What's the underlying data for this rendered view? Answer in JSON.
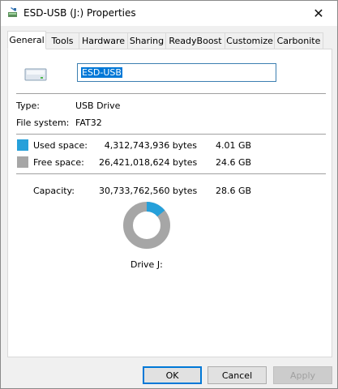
{
  "window": {
    "title": "ESD-USB (J:) Properties",
    "close_glyph": "✕"
  },
  "tabs": [
    {
      "label": "General",
      "active": true
    },
    {
      "label": "Tools",
      "active": false
    },
    {
      "label": "Hardware",
      "active": false
    },
    {
      "label": "Sharing",
      "active": false
    },
    {
      "label": "ReadyBoost",
      "active": false
    },
    {
      "label": "Customize",
      "active": false
    },
    {
      "label": "Carbonite",
      "active": false
    }
  ],
  "general": {
    "drive_icon": "usb-drive-icon",
    "name_value": "ESD-USB",
    "type_label": "Type:",
    "type_value": "USB Drive",
    "fs_label": "File system:",
    "fs_value": "FAT32",
    "used": {
      "label": "Used space:",
      "bytes": "4,312,743,936 bytes",
      "size": "4.01 GB",
      "color": "#26a0da",
      "fraction": 0.14
    },
    "free": {
      "label": "Free space:",
      "bytes": "26,421,018,624 bytes",
      "size": "24.6 GB",
      "color": "#a6a6a6"
    },
    "capacity": {
      "label": "Capacity:",
      "bytes": "30,733,762,560 bytes",
      "size": "28.6 GB"
    },
    "drive_label": "Drive J:"
  },
  "buttons": {
    "ok": "OK",
    "cancel": "Cancel",
    "apply": "Apply"
  }
}
